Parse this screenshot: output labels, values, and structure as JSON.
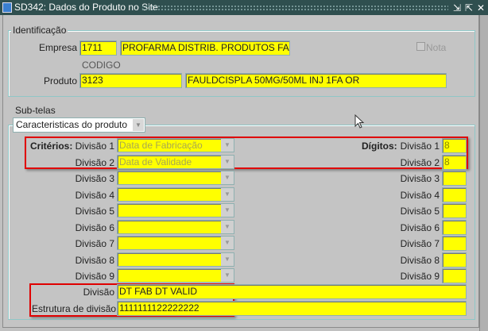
{
  "window": {
    "title": "SD342: Dados do Produto no Site",
    "minimize": "⇲",
    "maximize": "⇱",
    "close": "✕"
  },
  "identificacao": {
    "legend": "Identificação",
    "empresa_label": "Empresa",
    "empresa_code": "1711",
    "empresa_name": "PROFARMA DISTRIB. PRODUTOS FARM",
    "nota_label": "Nota",
    "codigo_label": "CODIGO",
    "produto_label": "Produto",
    "produto_code": "3123",
    "produto_desc": "FAULDCISPLA 50MG/50ML INJ 1FA OR"
  },
  "subtelas": {
    "label": "Sub-telas",
    "selected": "Caracteristicas do produto"
  },
  "criterios": {
    "label": "Critérios:",
    "digitos_label": "Dígitos:",
    "rows": [
      {
        "label": "Divisão 1",
        "value": "Data de Fabricação",
        "digits": "8"
      },
      {
        "label": "Divisão 2",
        "value": "Data de Validade",
        "digits": "8"
      },
      {
        "label": "Divisão 3",
        "value": "",
        "digits": ""
      },
      {
        "label": "Divisão 4",
        "value": "",
        "digits": ""
      },
      {
        "label": "Divisão 5",
        "value": "",
        "digits": ""
      },
      {
        "label": "Divisão 6",
        "value": "",
        "digits": ""
      },
      {
        "label": "Divisão 7",
        "value": "",
        "digits": ""
      },
      {
        "label": "Divisão 8",
        "value": "",
        "digits": ""
      },
      {
        "label": "Divisão 9",
        "value": "",
        "digits": ""
      }
    ]
  },
  "resultado": {
    "divisao_label": "Divisão",
    "divisao_value": "DT FAB  DT VALID",
    "estrutura_label": "Estrutura de divisão",
    "estrutura_value": "1111111122222222"
  }
}
